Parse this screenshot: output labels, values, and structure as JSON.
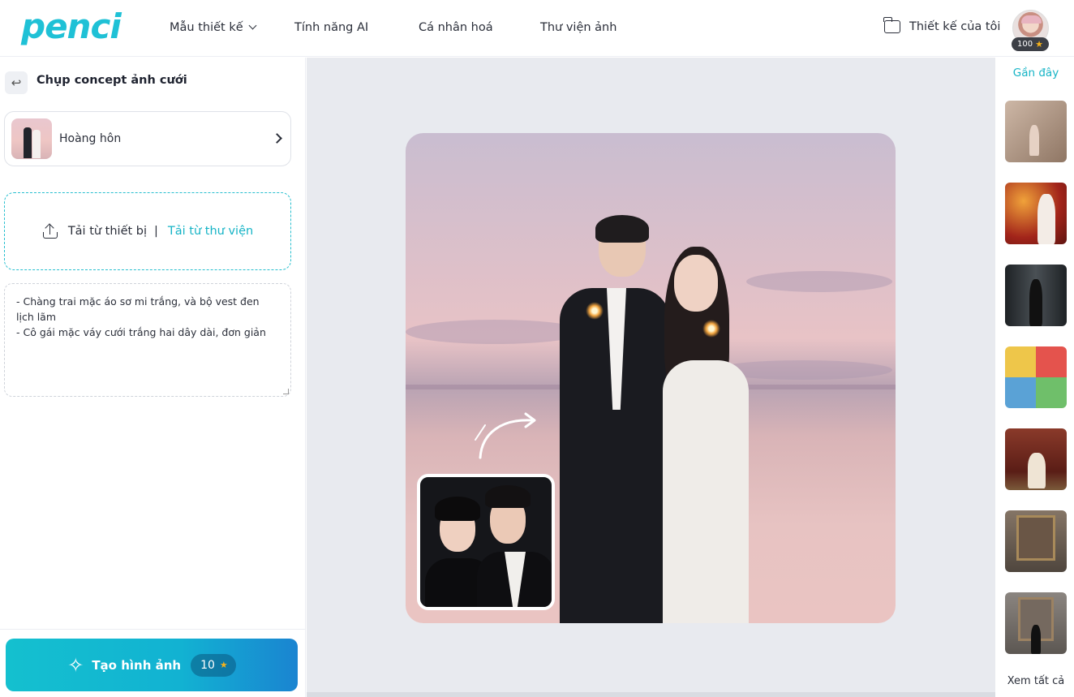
{
  "header": {
    "logo": "penci",
    "nav": [
      {
        "label": "Mẫu thiết kế",
        "has_dropdown": true
      },
      {
        "label": "Tính năng AI"
      },
      {
        "label": "Cá nhân hoá"
      },
      {
        "label": "Thư viện ảnh"
      }
    ],
    "my_designs": "Thiết kế của tôi",
    "credits": "100"
  },
  "left_panel": {
    "title": "Chụp concept ảnh cưới",
    "style_option": "Hoàng hôn",
    "upload": {
      "device_label": "Tải từ thiết bị",
      "separator": "|",
      "library_label": "Tải từ thư viện"
    },
    "prompt": "- Chàng trai mặc áo sơ mi trắng, và bộ vest đen lịch lãm\n- Cô gái mặc váy cưới trắng hai dây dài, đơn giản",
    "generate": {
      "label": "Tạo hình ảnh",
      "cost": "10"
    }
  },
  "right_rail": {
    "title": "Gần đây",
    "view_all": "Xem tất cả",
    "thumbnails": [
      {
        "name": "recent-thumb-1",
        "bg": "#b9a08c"
      },
      {
        "name": "recent-thumb-2",
        "bg": "#b2321f"
      },
      {
        "name": "recent-thumb-3",
        "bg": "#2e3236"
      },
      {
        "name": "recent-thumb-4",
        "bg": "#e7c346"
      },
      {
        "name": "recent-thumb-5",
        "bg": "#7a2a22"
      },
      {
        "name": "recent-thumb-6",
        "bg": "#6e6055"
      },
      {
        "name": "recent-thumb-7",
        "bg": "#7d7773"
      }
    ]
  },
  "colors": {
    "accent": "#16b4c6",
    "button_gradient_start": "#14c0cf",
    "button_gradient_end": "#1a84d1"
  }
}
